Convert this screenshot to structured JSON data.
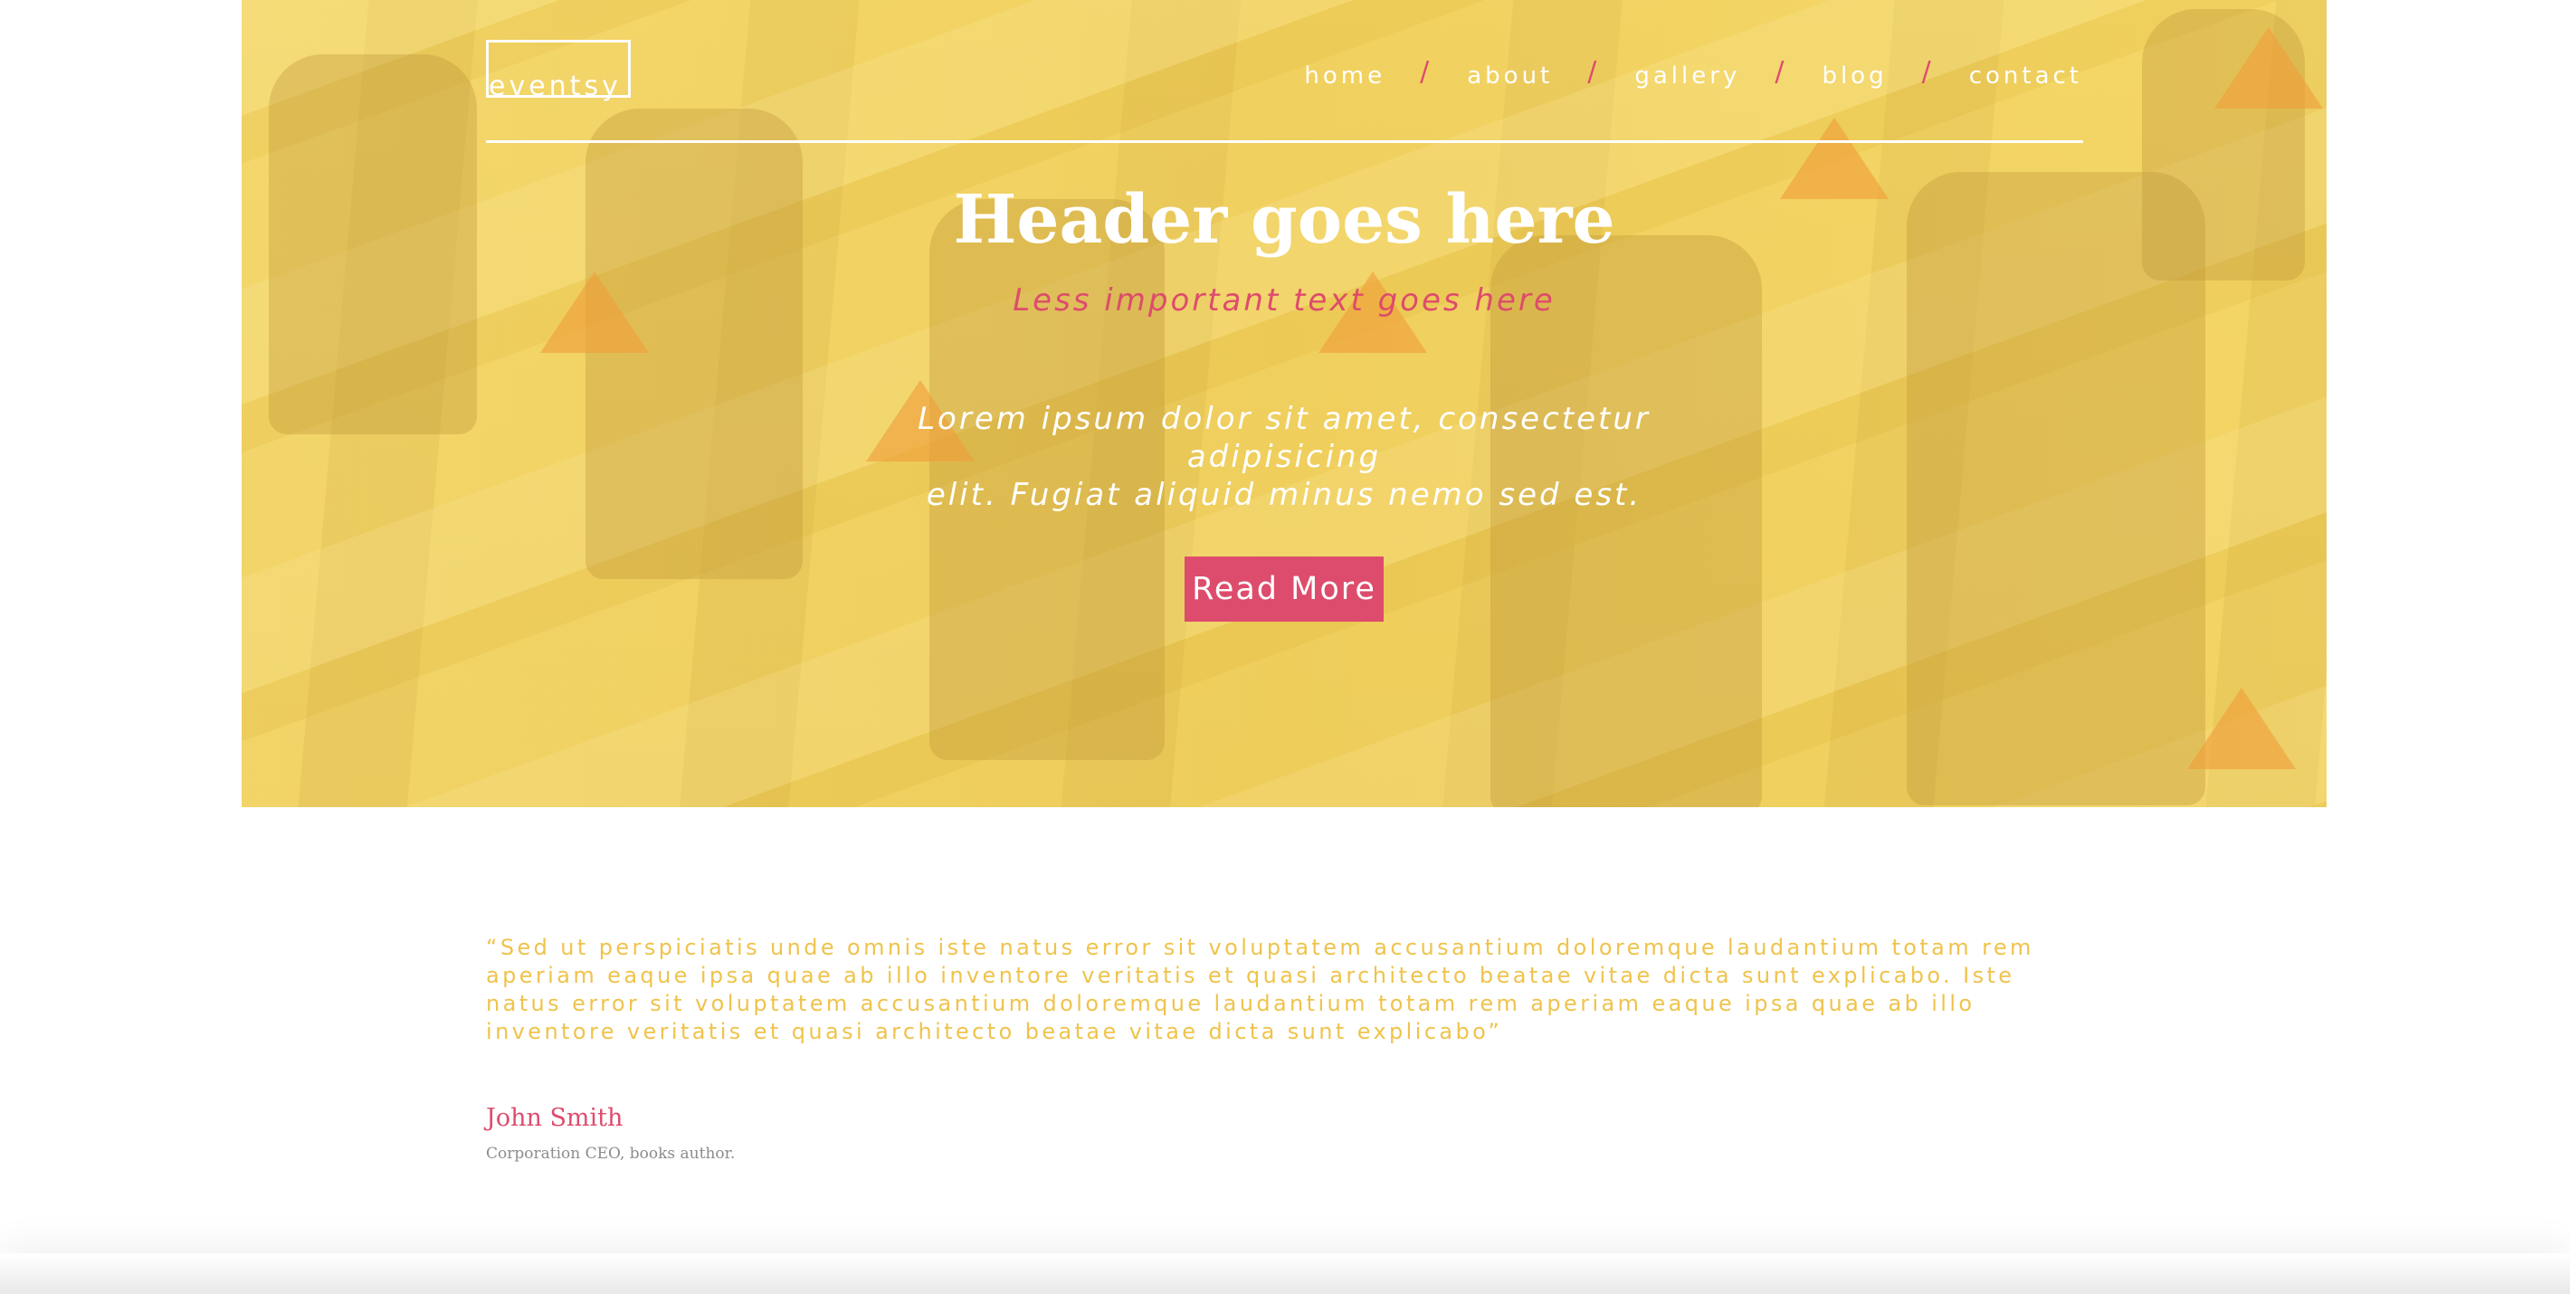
{
  "brand": {
    "logo_text": "eventsy"
  },
  "nav": {
    "items": [
      {
        "label": "home"
      },
      {
        "label": "about"
      },
      {
        "label": "gallery"
      },
      {
        "label": "blog"
      },
      {
        "label": "contact"
      }
    ],
    "separator": "/"
  },
  "hero": {
    "title": "Header goes here",
    "subtitle": "Less important text goes here",
    "description_line1": "Lorem ipsum dolor sit amet, consectetur adipisicing",
    "description_line2": "elit. Fugiat aliquid minus nemo sed est.",
    "cta_label": "Read More"
  },
  "testimonial": {
    "quote": "“Sed ut perspiciatis unde omnis iste natus error sit voluptatem accusantium doloremque laudantium totam rem aperiam eaque ipsa quae ab illo inventore veritatis et quasi architecto beatae vitae dicta sunt explicabo. Iste natus error sit voluptatem accusantium doloremque laudantium totam rem aperiam eaque ipsa quae ab illo inventore veritatis et quasi architecto beatae vitae dicta sunt explicabo”",
    "author_name": "John Smith",
    "author_role": "Corporation CEO, books author."
  },
  "colors": {
    "accent_pink": "#dd4c6c",
    "hero_yellow": "#ecce5b",
    "quote_yellow": "#efc34c",
    "muted_gray": "#8c8c8c"
  }
}
